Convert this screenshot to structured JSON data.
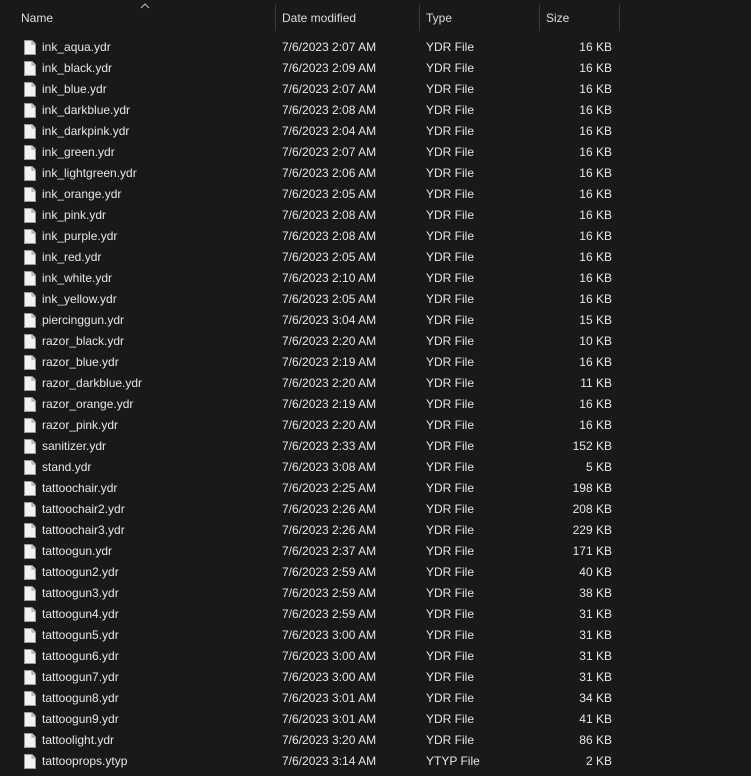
{
  "columns": {
    "name": "Name",
    "date": "Date modified",
    "type": "Type",
    "size": "Size"
  },
  "files": [
    {
      "name": "ink_aqua.ydr",
      "date": "7/6/2023 2:07 AM",
      "type": "YDR File",
      "size": "16 KB"
    },
    {
      "name": "ink_black.ydr",
      "date": "7/6/2023 2:09 AM",
      "type": "YDR File",
      "size": "16 KB"
    },
    {
      "name": "ink_blue.ydr",
      "date": "7/6/2023 2:07 AM",
      "type": "YDR File",
      "size": "16 KB"
    },
    {
      "name": "ink_darkblue.ydr",
      "date": "7/6/2023 2:08 AM",
      "type": "YDR File",
      "size": "16 KB"
    },
    {
      "name": "ink_darkpink.ydr",
      "date": "7/6/2023 2:04 AM",
      "type": "YDR File",
      "size": "16 KB"
    },
    {
      "name": "ink_green.ydr",
      "date": "7/6/2023 2:07 AM",
      "type": "YDR File",
      "size": "16 KB"
    },
    {
      "name": "ink_lightgreen.ydr",
      "date": "7/6/2023 2:06 AM",
      "type": "YDR File",
      "size": "16 KB"
    },
    {
      "name": "ink_orange.ydr",
      "date": "7/6/2023 2:05 AM",
      "type": "YDR File",
      "size": "16 KB"
    },
    {
      "name": "ink_pink.ydr",
      "date": "7/6/2023 2:08 AM",
      "type": "YDR File",
      "size": "16 KB"
    },
    {
      "name": "ink_purple.ydr",
      "date": "7/6/2023 2:08 AM",
      "type": "YDR File",
      "size": "16 KB"
    },
    {
      "name": "ink_red.ydr",
      "date": "7/6/2023 2:05 AM",
      "type": "YDR File",
      "size": "16 KB"
    },
    {
      "name": "ink_white.ydr",
      "date": "7/6/2023 2:10 AM",
      "type": "YDR File",
      "size": "16 KB"
    },
    {
      "name": "ink_yellow.ydr",
      "date": "7/6/2023 2:05 AM",
      "type": "YDR File",
      "size": "16 KB"
    },
    {
      "name": "piercinggun.ydr",
      "date": "7/6/2023 3:04 AM",
      "type": "YDR File",
      "size": "15 KB"
    },
    {
      "name": "razor_black.ydr",
      "date": "7/6/2023 2:20 AM",
      "type": "YDR File",
      "size": "10 KB"
    },
    {
      "name": "razor_blue.ydr",
      "date": "7/6/2023 2:19 AM",
      "type": "YDR File",
      "size": "16 KB"
    },
    {
      "name": "razor_darkblue.ydr",
      "date": "7/6/2023 2:20 AM",
      "type": "YDR File",
      "size": "11 KB"
    },
    {
      "name": "razor_orange.ydr",
      "date": "7/6/2023 2:19 AM",
      "type": "YDR File",
      "size": "16 KB"
    },
    {
      "name": "razor_pink.ydr",
      "date": "7/6/2023 2:20 AM",
      "type": "YDR File",
      "size": "16 KB"
    },
    {
      "name": "sanitizer.ydr",
      "date": "7/6/2023 2:33 AM",
      "type": "YDR File",
      "size": "152 KB"
    },
    {
      "name": "stand.ydr",
      "date": "7/6/2023 3:08 AM",
      "type": "YDR File",
      "size": "5 KB"
    },
    {
      "name": "tattoochair.ydr",
      "date": "7/6/2023 2:25 AM",
      "type": "YDR File",
      "size": "198 KB"
    },
    {
      "name": "tattoochair2.ydr",
      "date": "7/6/2023 2:26 AM",
      "type": "YDR File",
      "size": "208 KB"
    },
    {
      "name": "tattoochair3.ydr",
      "date": "7/6/2023 2:26 AM",
      "type": "YDR File",
      "size": "229 KB"
    },
    {
      "name": "tattoogun.ydr",
      "date": "7/6/2023 2:37 AM",
      "type": "YDR File",
      "size": "171 KB"
    },
    {
      "name": "tattoogun2.ydr",
      "date": "7/6/2023 2:59 AM",
      "type": "YDR File",
      "size": "40 KB"
    },
    {
      "name": "tattoogun3.ydr",
      "date": "7/6/2023 2:59 AM",
      "type": "YDR File",
      "size": "38 KB"
    },
    {
      "name": "tattoogun4.ydr",
      "date": "7/6/2023 2:59 AM",
      "type": "YDR File",
      "size": "31 KB"
    },
    {
      "name": "tattoogun5.ydr",
      "date": "7/6/2023 3:00 AM",
      "type": "YDR File",
      "size": "31 KB"
    },
    {
      "name": "tattoogun6.ydr",
      "date": "7/6/2023 3:00 AM",
      "type": "YDR File",
      "size": "31 KB"
    },
    {
      "name": "tattoogun7.ydr",
      "date": "7/6/2023 3:00 AM",
      "type": "YDR File",
      "size": "31 KB"
    },
    {
      "name": "tattoogun8.ydr",
      "date": "7/6/2023 3:01 AM",
      "type": "YDR File",
      "size": "34 KB"
    },
    {
      "name": "tattoogun9.ydr",
      "date": "7/6/2023 3:01 AM",
      "type": "YDR File",
      "size": "41 KB"
    },
    {
      "name": "tattoolight.ydr",
      "date": "7/6/2023 3:20 AM",
      "type": "YDR File",
      "size": "86 KB"
    },
    {
      "name": "tattooprops.ytyp",
      "date": "7/6/2023 3:14 AM",
      "type": "YTYP File",
      "size": "2 KB"
    }
  ],
  "icons": {
    "sort": "sort-ascending-icon",
    "file": "generic-file-icon"
  },
  "colors": {
    "background": "#191919",
    "text": "#e6e6e6",
    "separator": "#3a3a3a"
  }
}
